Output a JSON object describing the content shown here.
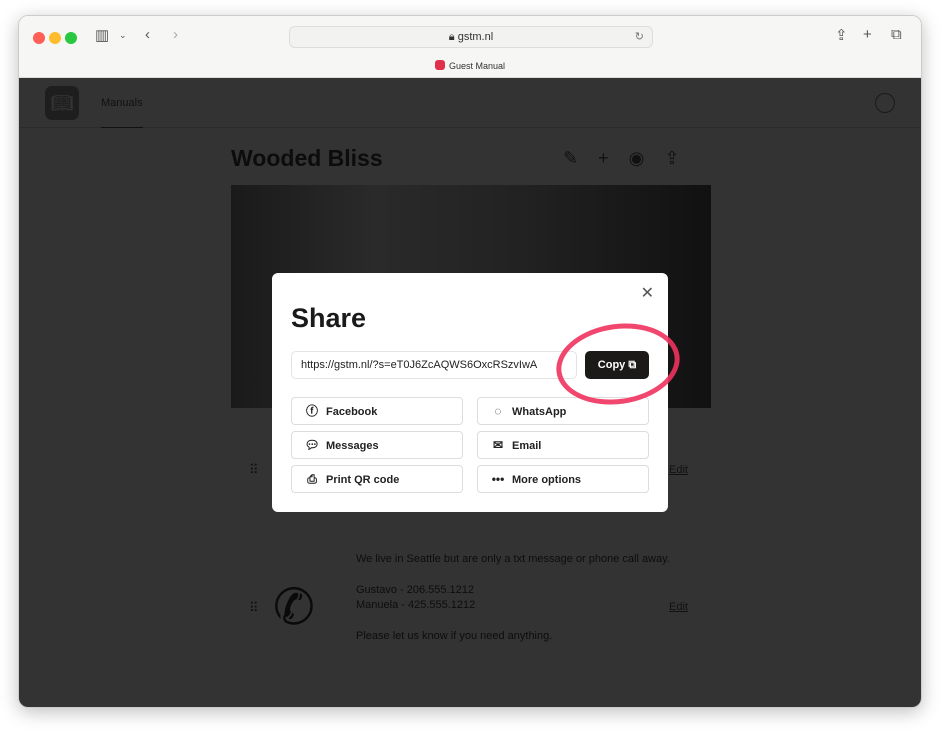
{
  "browser": {
    "url": "gstm.nl",
    "tab_title": "Guest Manual"
  },
  "nav": {
    "item": "Manuals"
  },
  "manual": {
    "title": "Wooded Bliss"
  },
  "contact": {
    "lines": [
      "We live in Seattle but are only a txt message or phone call away.",
      "",
      "Gustavo - 206.555.1212",
      "Manuela - 425.555.1212",
      "",
      "Please let us know if you need anything."
    ],
    "edit": "Edit"
  },
  "edit_label": "Edit",
  "share": {
    "title": "Share",
    "link": "https://gstm.nl/?s=eT0J6ZcAQWS6OxcRSzvIwA",
    "copy": "Copy",
    "options": [
      {
        "label": "Facebook",
        "icon": "facebook-icon"
      },
      {
        "label": "WhatsApp",
        "icon": "whatsapp-icon"
      },
      {
        "label": "Messages",
        "icon": "messages-icon"
      },
      {
        "label": "Email",
        "icon": "email-icon"
      },
      {
        "label": "Print QR code",
        "icon": "printer-icon"
      },
      {
        "label": "More options",
        "icon": "more-icon"
      }
    ]
  },
  "colors": {
    "highlight": "#f0335e",
    "copy_bg": "#1c1a18"
  }
}
